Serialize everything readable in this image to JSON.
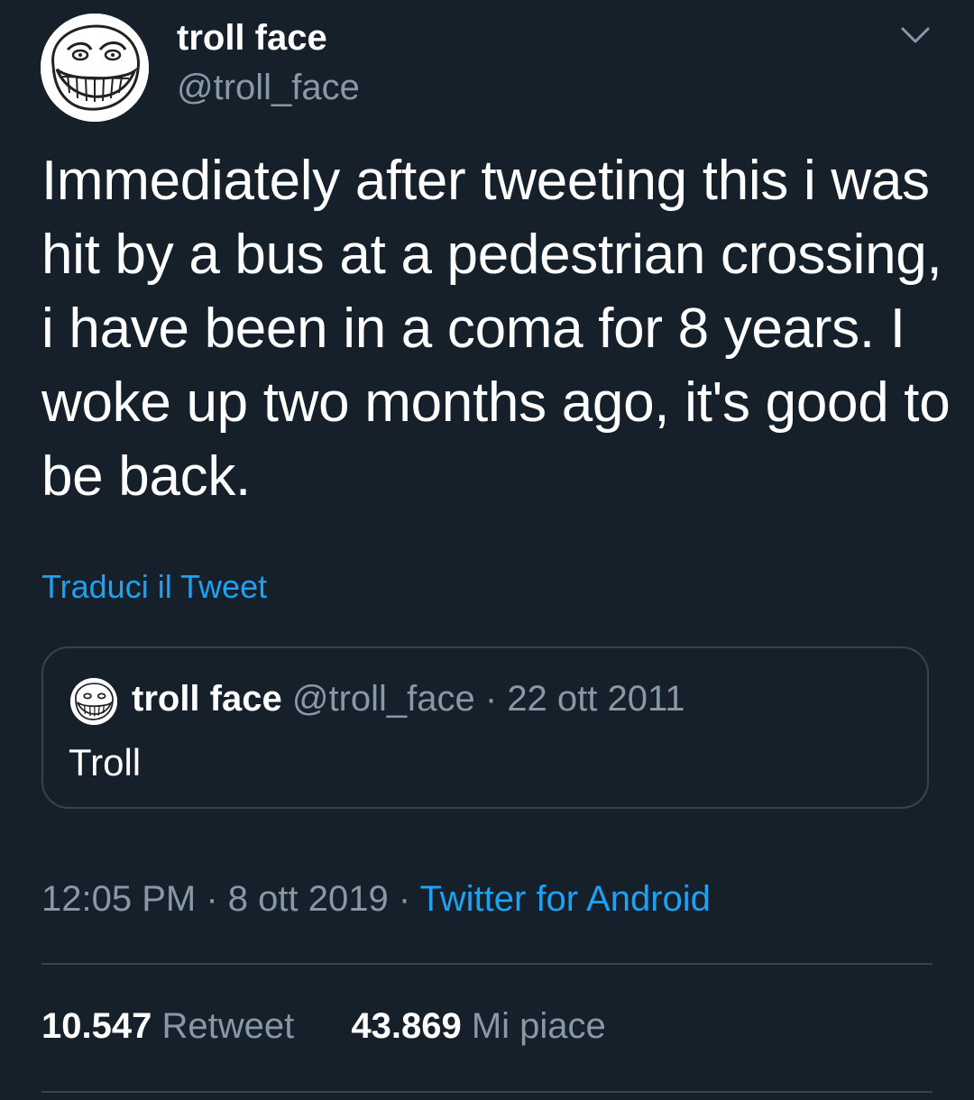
{
  "tweet": {
    "author": {
      "name": "troll face",
      "handle": "@troll_face",
      "avatar_icon": "troll-face-avatar"
    },
    "menu_icon": "chevron-down-icon",
    "text": "Immediately after tweeting this i was hit by a bus at a pedestrian crossing, i have been in a coma for 8 years. I woke up two months ago, it's good to be back.",
    "translate_label": "Traduci il Tweet",
    "quoted": {
      "name": "troll face",
      "handle": "@troll_face",
      "separator": " · ",
      "date": "22 ott 2011",
      "text": "Troll"
    },
    "meta": {
      "time": "12:05 PM",
      "date": "8 ott 2019",
      "separator": " · ",
      "source": "Twitter for Android"
    },
    "stats": {
      "retweets_count": "10.547",
      "retweets_label": "Retweet",
      "likes_count": "43.869",
      "likes_label": "Mi piace"
    }
  },
  "colors": {
    "background": "#15202b",
    "text_primary": "#ffffff",
    "text_secondary": "#8899a6",
    "link": "#1da1f2",
    "border": "#38444d"
  }
}
